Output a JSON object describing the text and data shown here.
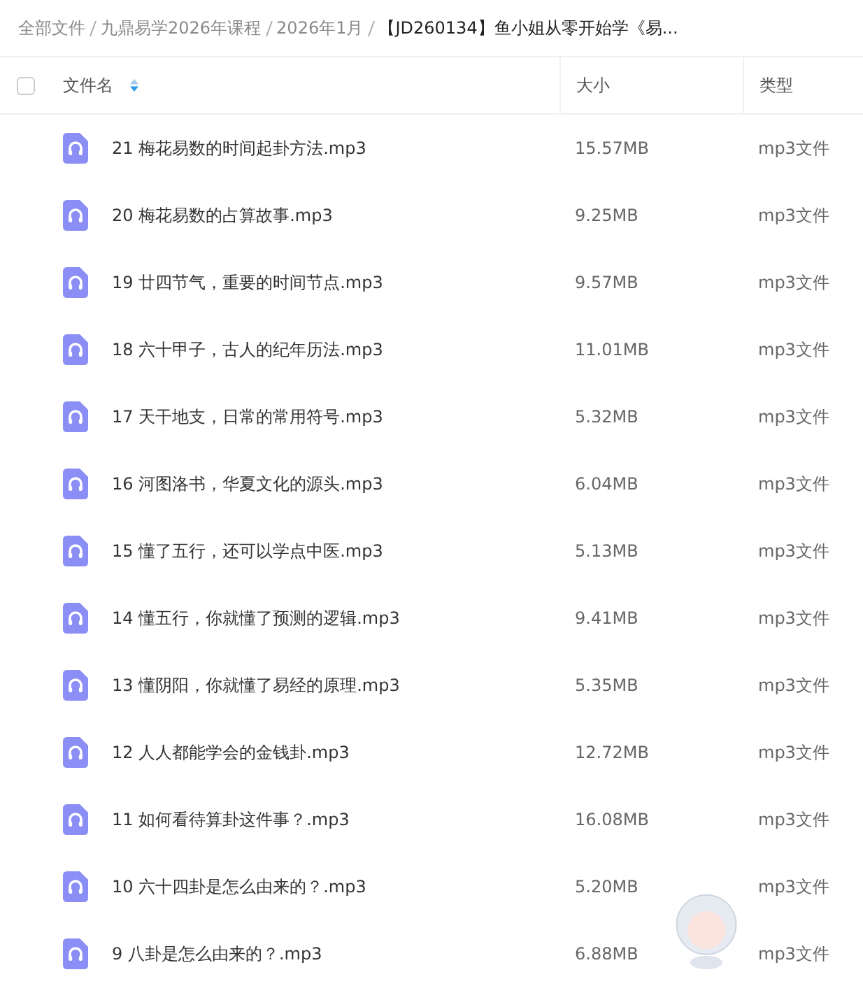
{
  "breadcrumb": [
    {
      "label": "全部文件",
      "current": false
    },
    {
      "label": "九鼎易学2026年课程",
      "current": false
    },
    {
      "label": "2026年1月",
      "current": false
    },
    {
      "label": "【JD260134】鱼小姐从零开始学《易...",
      "current": true
    }
  ],
  "table": {
    "select_all": {
      "checked": false
    },
    "columns": [
      {
        "label": "文件名",
        "sortable": true
      },
      {
        "label": "大小",
        "sortable": false
      },
      {
        "label": "类型",
        "sortable": false
      }
    ],
    "rows": [
      {
        "name": "21 梅花易数的时间起卦方法.mp3",
        "size": "15.57MB",
        "type": "mp3文件"
      },
      {
        "name": "20 梅花易数的占算故事.mp3",
        "size": "9.25MB",
        "type": "mp3文件"
      },
      {
        "name": "19 廿四节气，重要的时间节点.mp3",
        "size": "9.57MB",
        "type": "mp3文件"
      },
      {
        "name": "18 六十甲子，古人的纪年历法.mp3",
        "size": "11.01MB",
        "type": "mp3文件"
      },
      {
        "name": "17 天干地支，日常的常用符号.mp3",
        "size": "5.32MB",
        "type": "mp3文件"
      },
      {
        "name": "16 河图洛书，华夏文化的源头.mp3",
        "size": "6.04MB",
        "type": "mp3文件"
      },
      {
        "name": "15 懂了五行，还可以学点中医.mp3",
        "size": "5.13MB",
        "type": "mp3文件"
      },
      {
        "name": "14 懂五行，你就懂了预测的逻辑.mp3",
        "size": "9.41MB",
        "type": "mp3文件"
      },
      {
        "name": "13 懂阴阳，你就懂了易经的原理.mp3",
        "size": "5.35MB",
        "type": "mp3文件"
      },
      {
        "name": "12 人人都能学会的金钱卦.mp3",
        "size": "12.72MB",
        "type": "mp3文件"
      },
      {
        "name": "11 如何看待算卦这件事？.mp3",
        "size": "16.08MB",
        "type": "mp3文件"
      },
      {
        "name": "10 六十四卦是怎么由来的？.mp3",
        "size": "5.20MB",
        "type": "mp3文件"
      },
      {
        "name": "9 八卦是怎么由来的？.mp3",
        "size": "6.88MB",
        "type": "mp3文件"
      }
    ]
  }
}
